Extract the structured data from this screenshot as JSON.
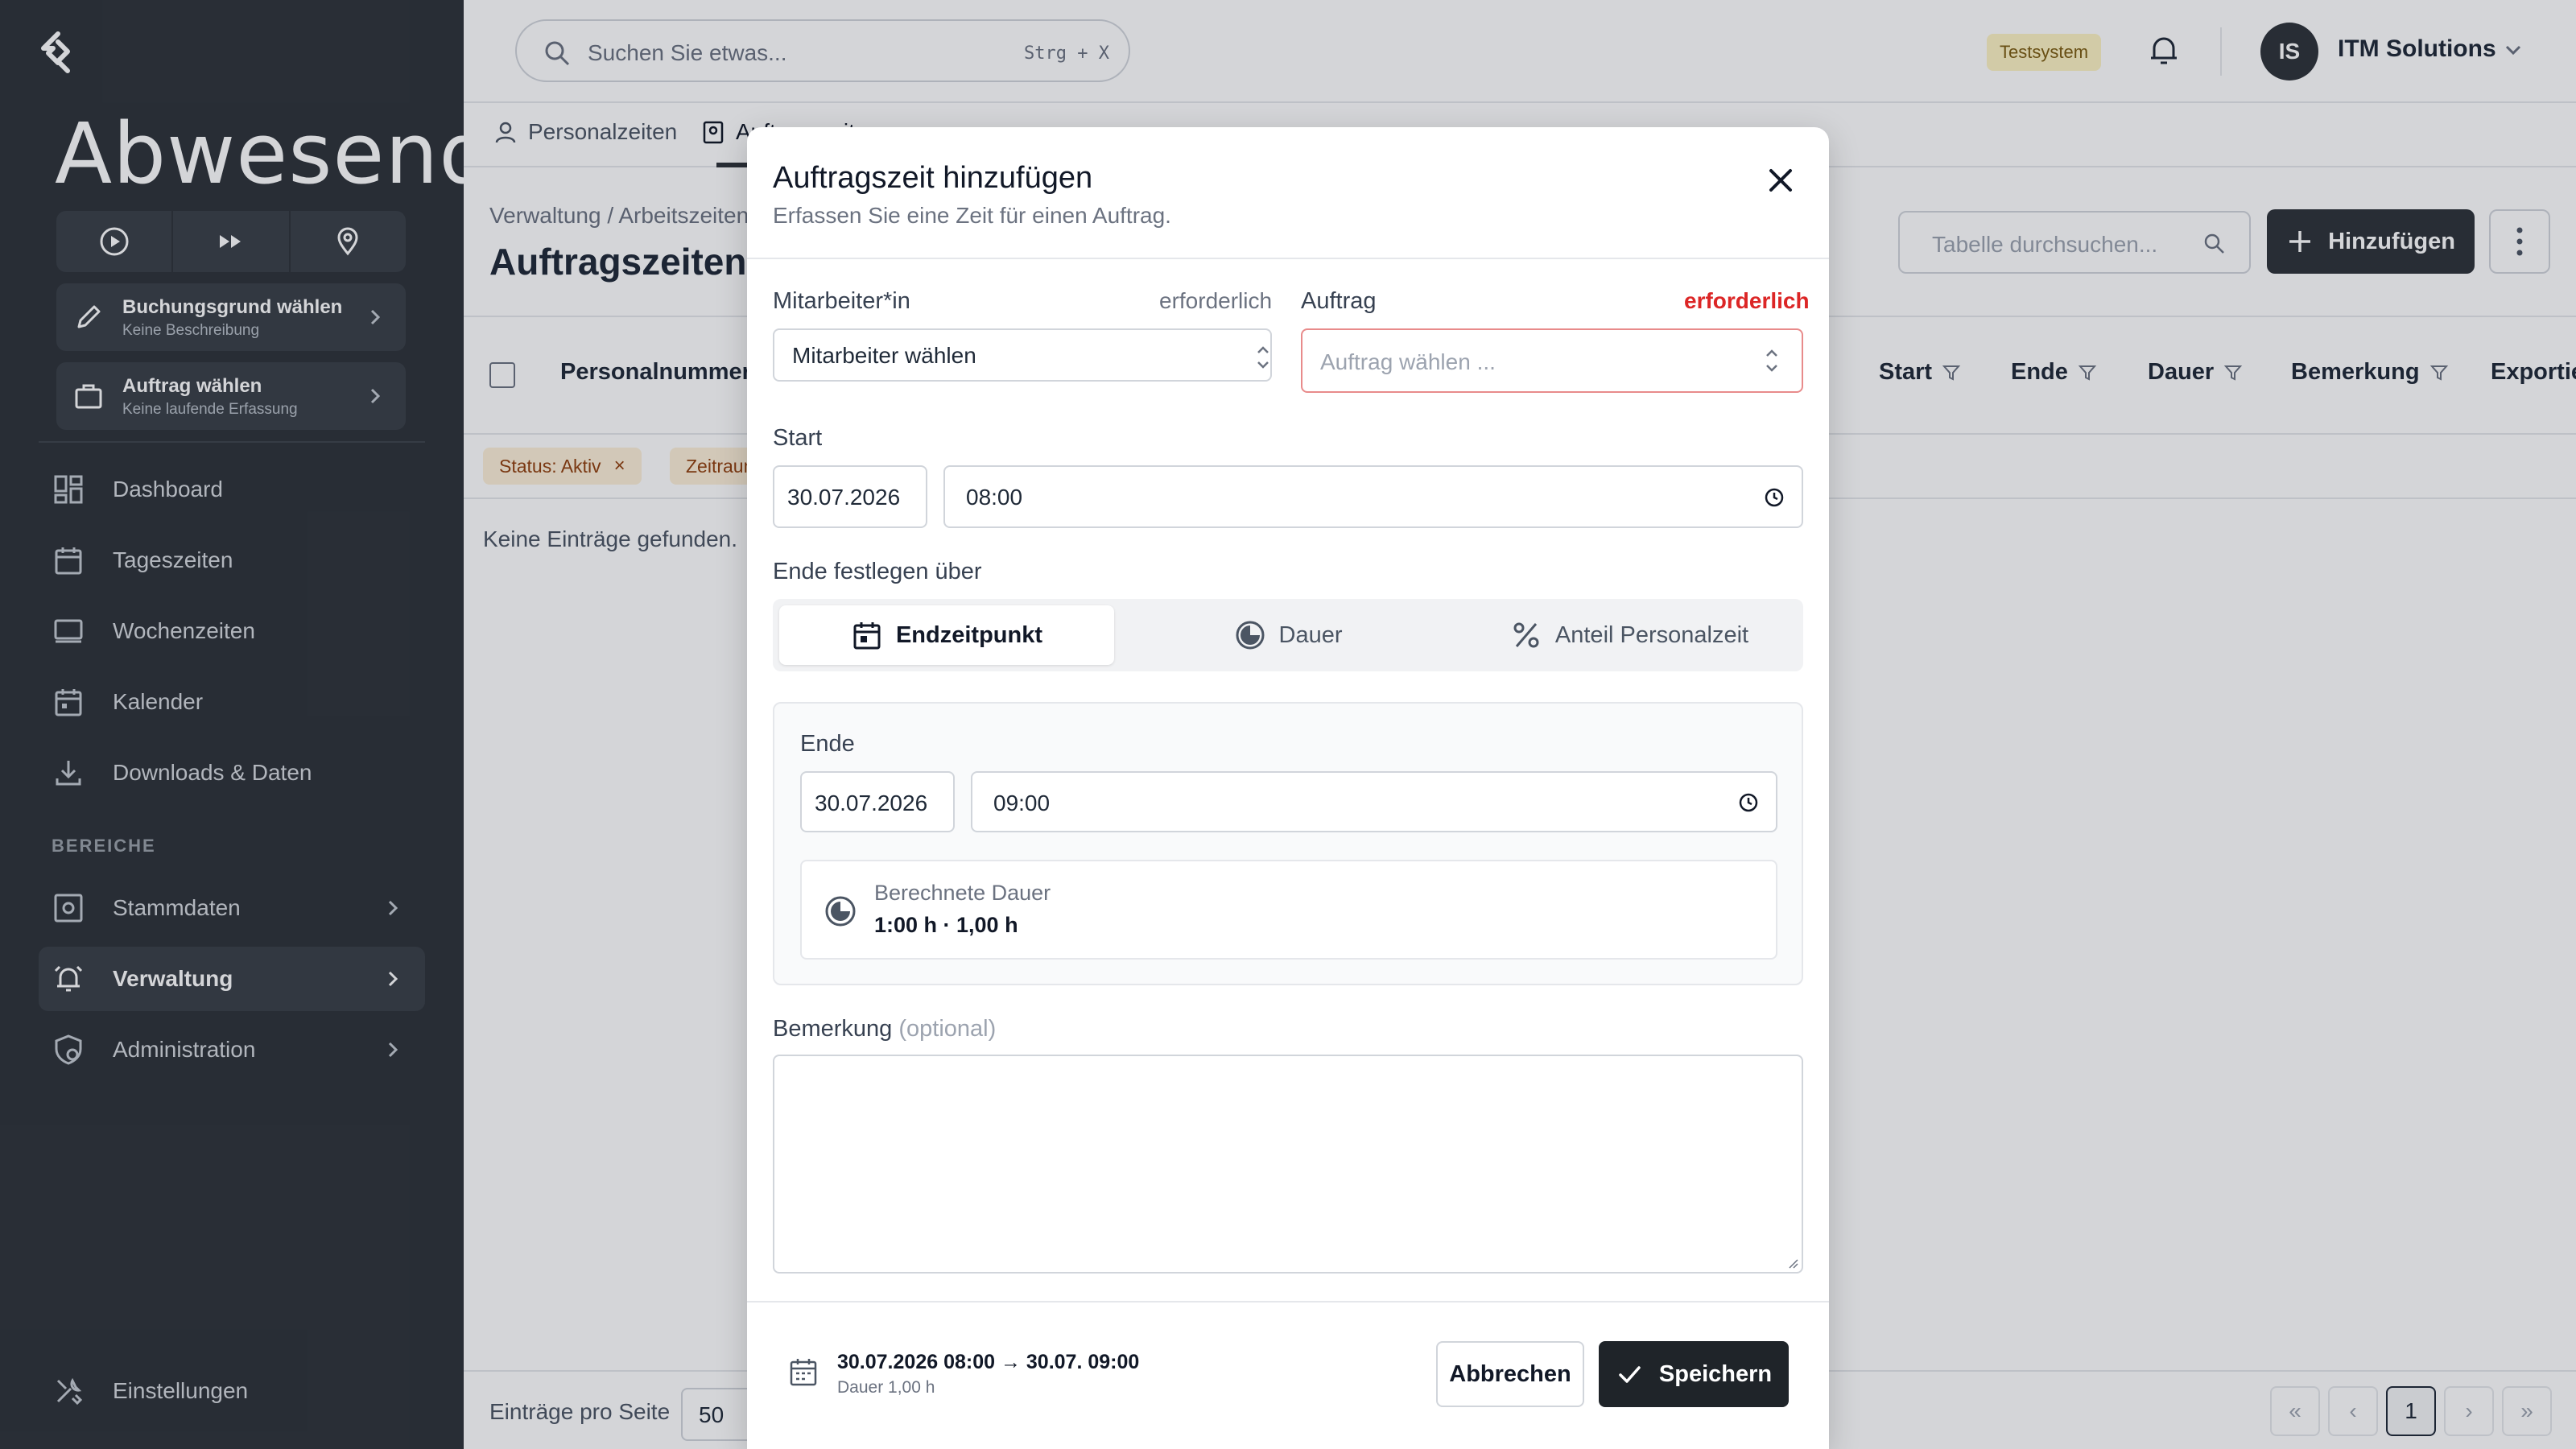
{
  "sidebar": {
    "brand": "Abwesend",
    "quick_actions": [
      "play-circle-icon",
      "fast-forward-icon",
      "location-pin-icon"
    ],
    "cards": [
      {
        "title": "Buchungsgrund wählen",
        "subtitle": "Keine Beschreibung"
      },
      {
        "title": "Auftrag wählen",
        "subtitle": "Keine laufende Erfassung"
      }
    ],
    "nav": [
      {
        "label": "Dashboard"
      },
      {
        "label": "Tageszeiten"
      },
      {
        "label": "Wochenzeiten"
      },
      {
        "label": "Kalender"
      },
      {
        "label": "Downloads & Daten"
      }
    ],
    "section_label": "BEREICHE",
    "areas": [
      {
        "label": "Stammdaten"
      },
      {
        "label": "Verwaltung",
        "active": true
      },
      {
        "label": "Administration"
      }
    ],
    "settings_label": "Einstellungen"
  },
  "topbar": {
    "search_placeholder": "Suchen Sie etwas...",
    "search_shortcut": "Strg + X",
    "env_badge": "Testsystem",
    "avatar_initials": "IS",
    "org_name": "ITM Solutions"
  },
  "tabs": [
    {
      "label": "Personalzeiten"
    },
    {
      "label": "Auftragszeiten"
    }
  ],
  "page": {
    "breadcrumb": "Verwaltung  /  Arbeitszeiten",
    "title": "Auftragszeiten",
    "table_search_placeholder": "Tabelle durchsuchen...",
    "add_label": "Hinzufügen",
    "columns": [
      "Personalnummer",
      "Start",
      "Ende",
      "Dauer",
      "Bemerkung",
      "Exportiert"
    ],
    "filters": [
      {
        "label": "Status: Aktiv"
      },
      {
        "label": "Zeitraum"
      }
    ],
    "empty": "Keine Einträge gefunden.",
    "per_page_label": "Einträge pro Seite",
    "per_page_value": "50",
    "current_page": "1"
  },
  "modal": {
    "title": "Auftragszeit hinzufügen",
    "subtitle": "Erfassen Sie eine Zeit für einen Auftrag.",
    "employee_label": "Mitarbeiter*in",
    "employee_required": "erforderlich",
    "employee_value": "Mitarbeiter wählen",
    "order_label": "Auftrag",
    "order_required": "erforderlich",
    "order_placeholder": "Auftrag wählen ...",
    "start_label": "Start",
    "start_date": "30.07.2026",
    "start_time": "08:00",
    "end_mode_label": "Ende festlegen über",
    "end_modes": [
      {
        "label": "Endzeitpunkt",
        "active": true
      },
      {
        "label": "Dauer",
        "active": false
      },
      {
        "label": "Anteil Personalzeit",
        "active": false
      }
    ],
    "end_label": "Ende",
    "end_date": "30.07.2026",
    "end_time": "09:00",
    "calc_label": "Berechnete Dauer",
    "calc_value": "1:00 h · 1,00 h",
    "remark_label": "Bemerkung",
    "remark_optional": "(optional)",
    "footer_range": "30.07.2026 08:00 → 30.07. 09:00",
    "footer_duration": "Dauer 1,00 h",
    "cancel_label": "Abbrechen",
    "save_label": "Speichern"
  }
}
